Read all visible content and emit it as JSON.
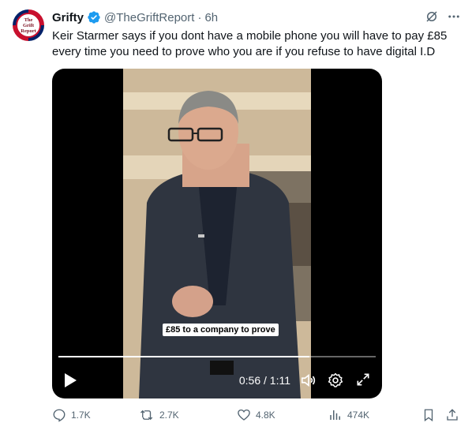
{
  "avatar": {
    "line1": "The",
    "line2": "Grift",
    "line3": "Report"
  },
  "tweet": {
    "display_name": "Grifty",
    "handle": "@TheGriftReport",
    "separator": "·",
    "time": "6h",
    "text": "Keir Starmer says if you dont have a mobile phone you will have to pay £85 every time you need to prove who you are if you refuse to have digital I.D"
  },
  "video": {
    "caption": "£85 to a company to prove",
    "timecode": "0:56 / 1:11",
    "progress": 0.79
  },
  "actions": {
    "replies": "1.7K",
    "reposts": "2.7K",
    "likes": "4.8K",
    "views": "474K"
  },
  "colors": {
    "verified": "#1d9bf0",
    "muted": "#536471"
  }
}
